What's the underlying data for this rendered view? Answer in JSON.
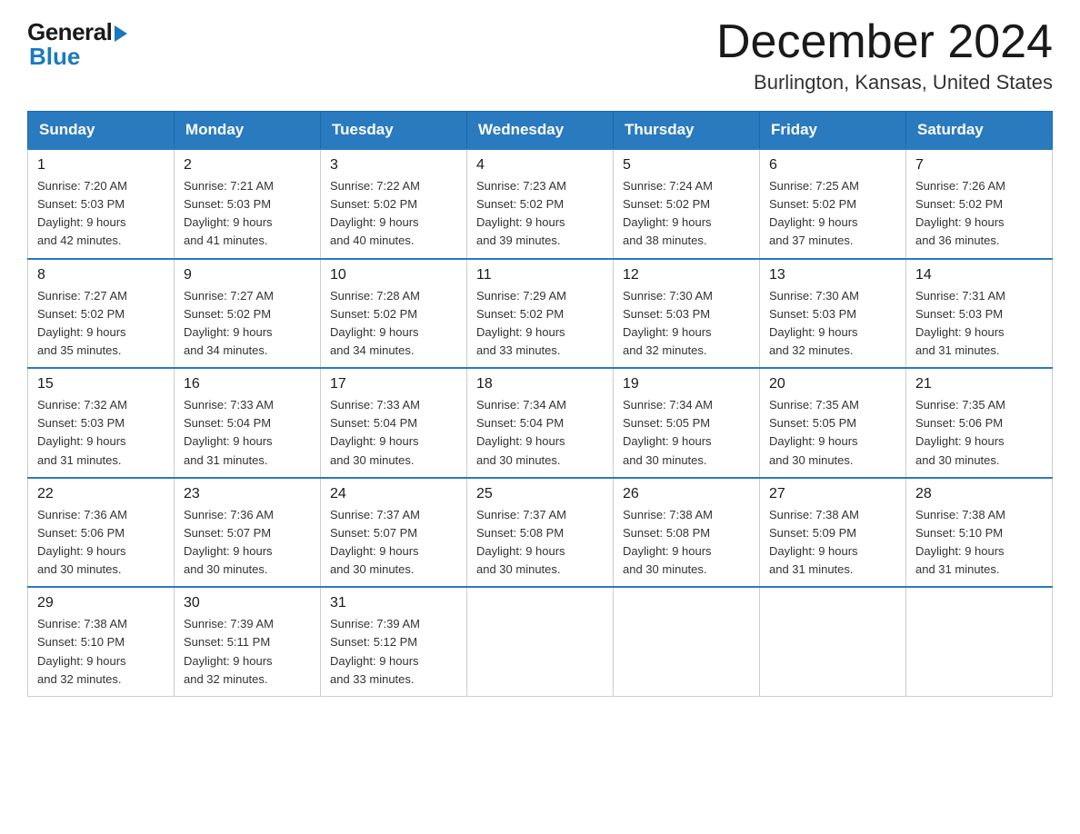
{
  "logo": {
    "general": "General",
    "blue": "Blue"
  },
  "title": "December 2024",
  "location": "Burlington, Kansas, United States",
  "days_of_week": [
    "Sunday",
    "Monday",
    "Tuesday",
    "Wednesday",
    "Thursday",
    "Friday",
    "Saturday"
  ],
  "weeks": [
    [
      {
        "day": "1",
        "sunrise": "7:20 AM",
        "sunset": "5:03 PM",
        "daylight": "9 hours and 42 minutes."
      },
      {
        "day": "2",
        "sunrise": "7:21 AM",
        "sunset": "5:03 PM",
        "daylight": "9 hours and 41 minutes."
      },
      {
        "day": "3",
        "sunrise": "7:22 AM",
        "sunset": "5:02 PM",
        "daylight": "9 hours and 40 minutes."
      },
      {
        "day": "4",
        "sunrise": "7:23 AM",
        "sunset": "5:02 PM",
        "daylight": "9 hours and 39 minutes."
      },
      {
        "day": "5",
        "sunrise": "7:24 AM",
        "sunset": "5:02 PM",
        "daylight": "9 hours and 38 minutes."
      },
      {
        "day": "6",
        "sunrise": "7:25 AM",
        "sunset": "5:02 PM",
        "daylight": "9 hours and 37 minutes."
      },
      {
        "day": "7",
        "sunrise": "7:26 AM",
        "sunset": "5:02 PM",
        "daylight": "9 hours and 36 minutes."
      }
    ],
    [
      {
        "day": "8",
        "sunrise": "7:27 AM",
        "sunset": "5:02 PM",
        "daylight": "9 hours and 35 minutes."
      },
      {
        "day": "9",
        "sunrise": "7:27 AM",
        "sunset": "5:02 PM",
        "daylight": "9 hours and 34 minutes."
      },
      {
        "day": "10",
        "sunrise": "7:28 AM",
        "sunset": "5:02 PM",
        "daylight": "9 hours and 34 minutes."
      },
      {
        "day": "11",
        "sunrise": "7:29 AM",
        "sunset": "5:02 PM",
        "daylight": "9 hours and 33 minutes."
      },
      {
        "day": "12",
        "sunrise": "7:30 AM",
        "sunset": "5:03 PM",
        "daylight": "9 hours and 32 minutes."
      },
      {
        "day": "13",
        "sunrise": "7:30 AM",
        "sunset": "5:03 PM",
        "daylight": "9 hours and 32 minutes."
      },
      {
        "day": "14",
        "sunrise": "7:31 AM",
        "sunset": "5:03 PM",
        "daylight": "9 hours and 31 minutes."
      }
    ],
    [
      {
        "day": "15",
        "sunrise": "7:32 AM",
        "sunset": "5:03 PM",
        "daylight": "9 hours and 31 minutes."
      },
      {
        "day": "16",
        "sunrise": "7:33 AM",
        "sunset": "5:04 PM",
        "daylight": "9 hours and 31 minutes."
      },
      {
        "day": "17",
        "sunrise": "7:33 AM",
        "sunset": "5:04 PM",
        "daylight": "9 hours and 30 minutes."
      },
      {
        "day": "18",
        "sunrise": "7:34 AM",
        "sunset": "5:04 PM",
        "daylight": "9 hours and 30 minutes."
      },
      {
        "day": "19",
        "sunrise": "7:34 AM",
        "sunset": "5:05 PM",
        "daylight": "9 hours and 30 minutes."
      },
      {
        "day": "20",
        "sunrise": "7:35 AM",
        "sunset": "5:05 PM",
        "daylight": "9 hours and 30 minutes."
      },
      {
        "day": "21",
        "sunrise": "7:35 AM",
        "sunset": "5:06 PM",
        "daylight": "9 hours and 30 minutes."
      }
    ],
    [
      {
        "day": "22",
        "sunrise": "7:36 AM",
        "sunset": "5:06 PM",
        "daylight": "9 hours and 30 minutes."
      },
      {
        "day": "23",
        "sunrise": "7:36 AM",
        "sunset": "5:07 PM",
        "daylight": "9 hours and 30 minutes."
      },
      {
        "day": "24",
        "sunrise": "7:37 AM",
        "sunset": "5:07 PM",
        "daylight": "9 hours and 30 minutes."
      },
      {
        "day": "25",
        "sunrise": "7:37 AM",
        "sunset": "5:08 PM",
        "daylight": "9 hours and 30 minutes."
      },
      {
        "day": "26",
        "sunrise": "7:38 AM",
        "sunset": "5:08 PM",
        "daylight": "9 hours and 30 minutes."
      },
      {
        "day": "27",
        "sunrise": "7:38 AM",
        "sunset": "5:09 PM",
        "daylight": "9 hours and 31 minutes."
      },
      {
        "day": "28",
        "sunrise": "7:38 AM",
        "sunset": "5:10 PM",
        "daylight": "9 hours and 31 minutes."
      }
    ],
    [
      {
        "day": "29",
        "sunrise": "7:38 AM",
        "sunset": "5:10 PM",
        "daylight": "9 hours and 32 minutes."
      },
      {
        "day": "30",
        "sunrise": "7:39 AM",
        "sunset": "5:11 PM",
        "daylight": "9 hours and 32 minutes."
      },
      {
        "day": "31",
        "sunrise": "7:39 AM",
        "sunset": "5:12 PM",
        "daylight": "9 hours and 33 minutes."
      },
      null,
      null,
      null,
      null
    ]
  ]
}
